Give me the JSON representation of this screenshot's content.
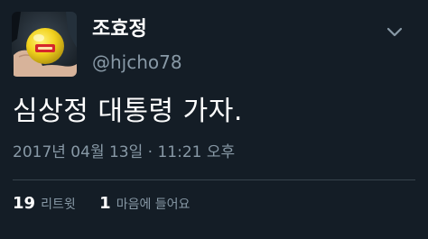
{
  "tweet": {
    "display_name": "조효정",
    "handle": "@hjcho78",
    "text": "심상정 대통령 가자.",
    "timestamp": "2017년 04월 13일 · 11:21 오후",
    "stats": {
      "retweets_count": "19",
      "retweets_label": "리트윗",
      "likes_count": "1",
      "likes_label": "마음에 들어요"
    },
    "menu_icon": "chevron-down-icon",
    "avatar_icon": "apple-photo"
  },
  "colors": {
    "background": "#141d26",
    "primary_text": "#ffffff",
    "secondary_text": "#8899a6",
    "divider": "#38444d"
  }
}
